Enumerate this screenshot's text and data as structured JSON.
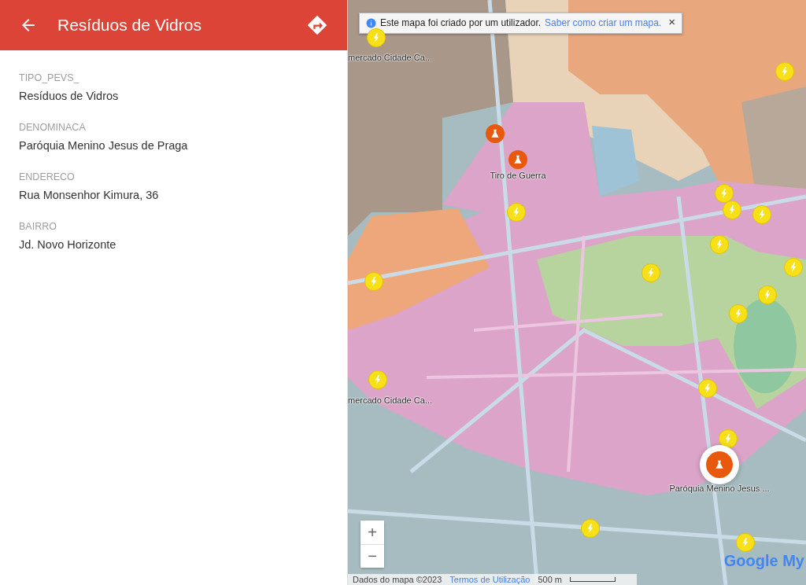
{
  "panel": {
    "title": "Resíduos de Vidros",
    "fields": [
      {
        "label": "TIPO_PEVS_",
        "value": "Resíduos de Vidros"
      },
      {
        "label": "DENOMINACA",
        "value": "Paróquia Menino Jesus de Praga"
      },
      {
        "label": "ENDERECO",
        "value": "Rua Monsenhor Kimura, 36"
      },
      {
        "label": "BAIRRO",
        "value": "Jd. Novo Horizonte"
      }
    ]
  },
  "map": {
    "kind": "picture",
    "notice": {
      "text": "Este mapa foi criado por um utilizador.",
      "link": "Saber como criar um mapa.",
      "close": "×"
    },
    "markers": [
      {
        "kind": "bolt",
        "selected": false
      },
      {
        "kind": "bolt",
        "selected": false
      },
      {
        "kind": "bolt",
        "selected": false
      },
      {
        "kind": "bolt",
        "selected": false
      },
      {
        "kind": "bolt",
        "selected": false
      },
      {
        "kind": "bolt",
        "selected": false
      },
      {
        "kind": "bolt",
        "selected": false
      },
      {
        "kind": "bolt",
        "selected": false
      },
      {
        "kind": "bolt",
        "selected": false
      },
      {
        "kind": "bolt",
        "selected": false
      },
      {
        "kind": "bolt",
        "selected": false
      },
      {
        "kind": "bolt",
        "selected": false
      },
      {
        "kind": "bolt",
        "selected": false
      },
      {
        "kind": "bolt",
        "selected": false
      },
      {
        "kind": "bolt",
        "selected": false
      },
      {
        "kind": "bolt",
        "selected": false
      },
      {
        "kind": "bolt",
        "selected": false
      },
      {
        "kind": "flask",
        "selected": false
      },
      {
        "kind": "flask",
        "selected": false,
        "label": "Tiro de Guerra"
      },
      {
        "kind": "flask",
        "selected": true,
        "label": "Paróquia Menino Jesus ..."
      },
      {
        "kind": "label",
        "label": "mercado Cidade Ca..."
      },
      {
        "kind": "label",
        "label": "mercado Cidade Ca..."
      }
    ],
    "zoom": {
      "in": "+",
      "out": "−"
    },
    "logo": "Google My",
    "footer": {
      "data": "Dados do mapa ©2023",
      "terms": "Termos de Utilização",
      "scale": "500 m"
    }
  }
}
